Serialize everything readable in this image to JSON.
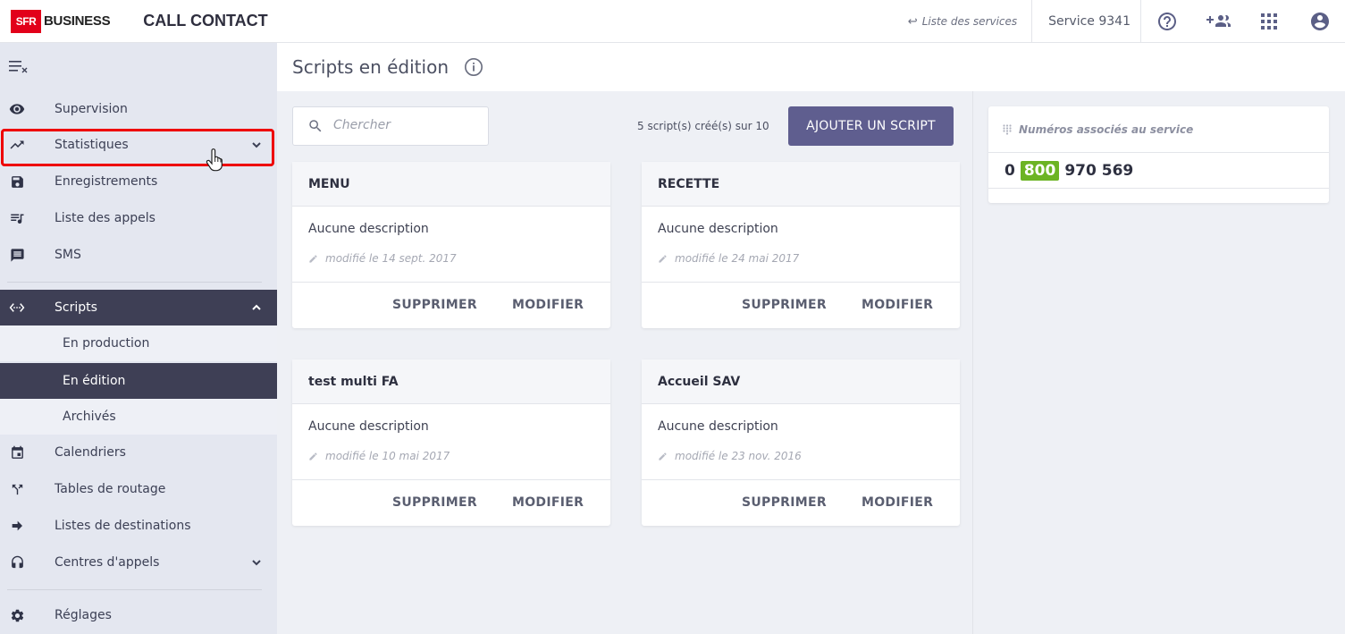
{
  "header": {
    "logo_brand": "SFR",
    "logo_suffix": "BUSINESS",
    "app_title": "CALL CONTACT",
    "services_link": "Liste des services",
    "service_name": "Service 9341",
    "icons": [
      "help-icon",
      "add-group-icon",
      "apps-grid-icon",
      "account-icon"
    ]
  },
  "sidebar": {
    "items": [
      {
        "label": "Supervision",
        "icon": "eye-icon"
      },
      {
        "label": "Statistiques",
        "icon": "trending-up-icon"
      },
      {
        "label": "Enregistrements",
        "icon": "save-icon"
      },
      {
        "label": "Liste des appels",
        "icon": "queue-music-icon"
      },
      {
        "label": "SMS",
        "icon": "message-icon"
      },
      {
        "label": "Scripts",
        "icon": "code-icon"
      },
      {
        "label": "Calendriers",
        "icon": "calendar-icon"
      },
      {
        "label": "Tables de routage",
        "icon": "call-split-icon"
      },
      {
        "label": "Listes de destinations",
        "icon": "arrow-right-icon"
      },
      {
        "label": "Centres d'appels",
        "icon": "headset-icon"
      },
      {
        "label": "Réglages",
        "icon": "gear-icon"
      }
    ],
    "scripts_sub": [
      {
        "label": "En production"
      },
      {
        "label": "En édition"
      },
      {
        "label": "Archivés"
      }
    ]
  },
  "page": {
    "title": "Scripts en édition",
    "search_placeholder": "Chercher",
    "count_text": "5 script(s) créé(s) sur 10",
    "add_button": "AJOUTER UN SCRIPT"
  },
  "cards": [
    {
      "name": "MENU",
      "description": "Aucune description",
      "modified": "modifié le 14 sept. 2017",
      "delete": "SUPPRIMER",
      "edit": "MODIFIER"
    },
    {
      "name": "RECETTE",
      "description": "Aucune description",
      "modified": "modifié le 24 mai 2017",
      "delete": "SUPPRIMER",
      "edit": "MODIFIER"
    },
    {
      "name": "test multi FA",
      "description": "Aucune description",
      "modified": "modifié le 10 mai 2017",
      "delete": "SUPPRIMER",
      "edit": "MODIFIER"
    },
    {
      "name": "Accueil SAV",
      "description": "Aucune description",
      "modified": "modifié le 23 nov. 2016",
      "delete": "SUPPRIMER",
      "edit": "MODIFIER"
    }
  ],
  "numbers_panel": {
    "title": "Numéros associés au service",
    "number_prefix": "0",
    "number_badge": "800",
    "number_rest": "970 569"
  },
  "colors": {
    "brand_red": "#e2001a",
    "active_nav": "#3e3f55",
    "primary_button": "#5f5e8f",
    "number_badge": "#6cb424",
    "highlight": "#ee0000"
  }
}
